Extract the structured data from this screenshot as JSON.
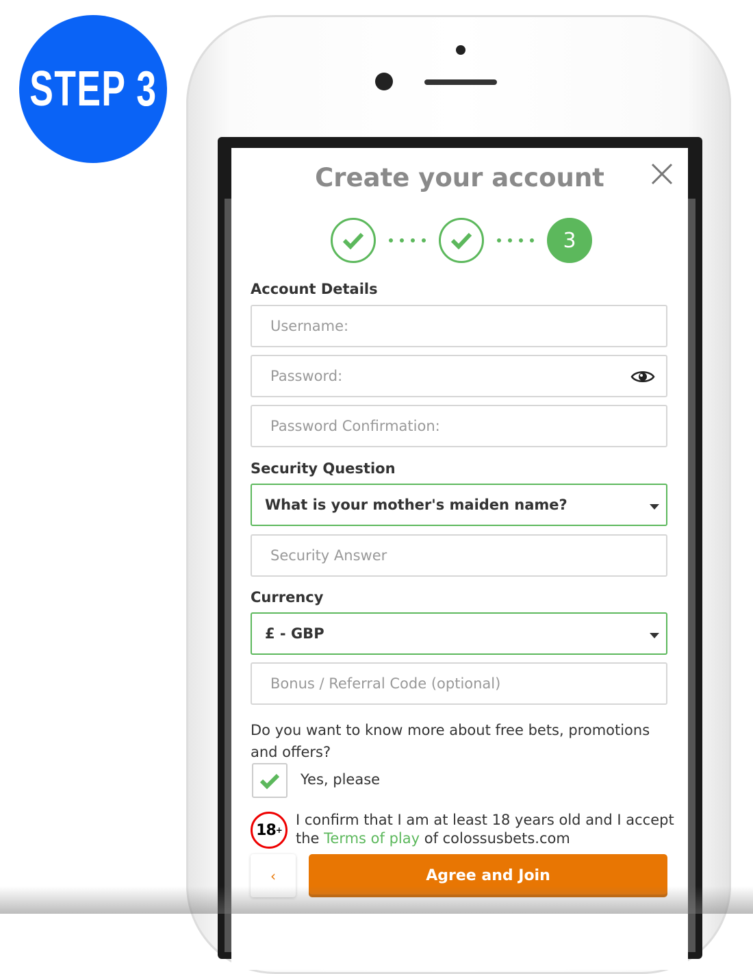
{
  "colors": {
    "blue": "#0a63f6",
    "green": "#5cb85c",
    "orange": "#e87603"
  },
  "badge": {
    "text": "STEP 3"
  },
  "modal": {
    "title": "Create your account",
    "close_icon": "close-icon",
    "steps": [
      {
        "state": "done",
        "icon": "check-icon"
      },
      {
        "state": "done",
        "icon": "check-icon"
      },
      {
        "state": "active",
        "label": "3"
      }
    ],
    "account_details": {
      "heading": "Account Details",
      "username_placeholder": "Username:",
      "password_placeholder": "Password:",
      "password_confirm_placeholder": "Password Confirmation:",
      "eye_icon": "eye-icon"
    },
    "security": {
      "heading": "Security Question",
      "selected": "What is your mother's maiden name?",
      "answer_placeholder": "Security Answer"
    },
    "currency": {
      "heading": "Currency",
      "selected": "£ - GBP",
      "bonus_placeholder": "Bonus / Referral Code (optional)"
    },
    "promo": {
      "question": "Do you want to know more about free bets, promotions and offers?",
      "checkbox_label": "Yes, please",
      "checked": true
    },
    "age": {
      "badge": "18",
      "badge_sup": "+",
      "text_before": "I confirm that I am at least 18 years old and I accept the ",
      "link": "Terms of play",
      "text_after": " of colossusbets.com"
    },
    "buttons": {
      "back": "‹",
      "join": "Agree and Join"
    }
  }
}
